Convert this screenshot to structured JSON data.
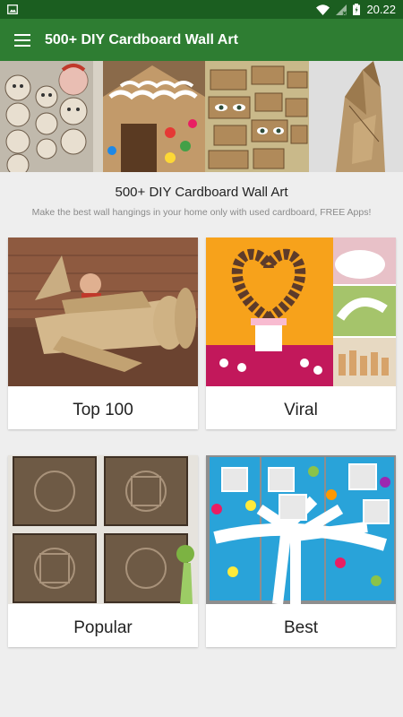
{
  "status_bar": {
    "time": "20.22",
    "icons": [
      "image-notification-icon",
      "wifi-icon",
      "signal-icon",
      "battery-icon"
    ]
  },
  "app_bar": {
    "menu_icon": "hamburger-menu-icon",
    "title": "500+ DIY Cardboard Wall Art"
  },
  "banner": {
    "images": [
      "cardboard-face-totems",
      "cardboard-gingerbread-house",
      "cardboard-eye-wall-art",
      "cardboard-sculpture"
    ]
  },
  "app_info": {
    "name": "500+ DIY Cardboard Wall Art",
    "description": "Make the best wall hangings in your home only with used cardboard, FREE Apps!"
  },
  "categories": [
    {
      "label": "Top 100",
      "image": "cardboard-airplane-with-child"
    },
    {
      "label": "Viral",
      "image": "cardboard-tube-heart-collage"
    },
    {
      "label": "Popular",
      "image": "embossed-cardboard-tiles"
    },
    {
      "label": "Best",
      "image": "family-tree-canvas"
    }
  ],
  "colors": {
    "status_bar": "#1b5e20",
    "app_bar": "#2e7d32",
    "background": "#eeeeee",
    "card": "#ffffff"
  }
}
